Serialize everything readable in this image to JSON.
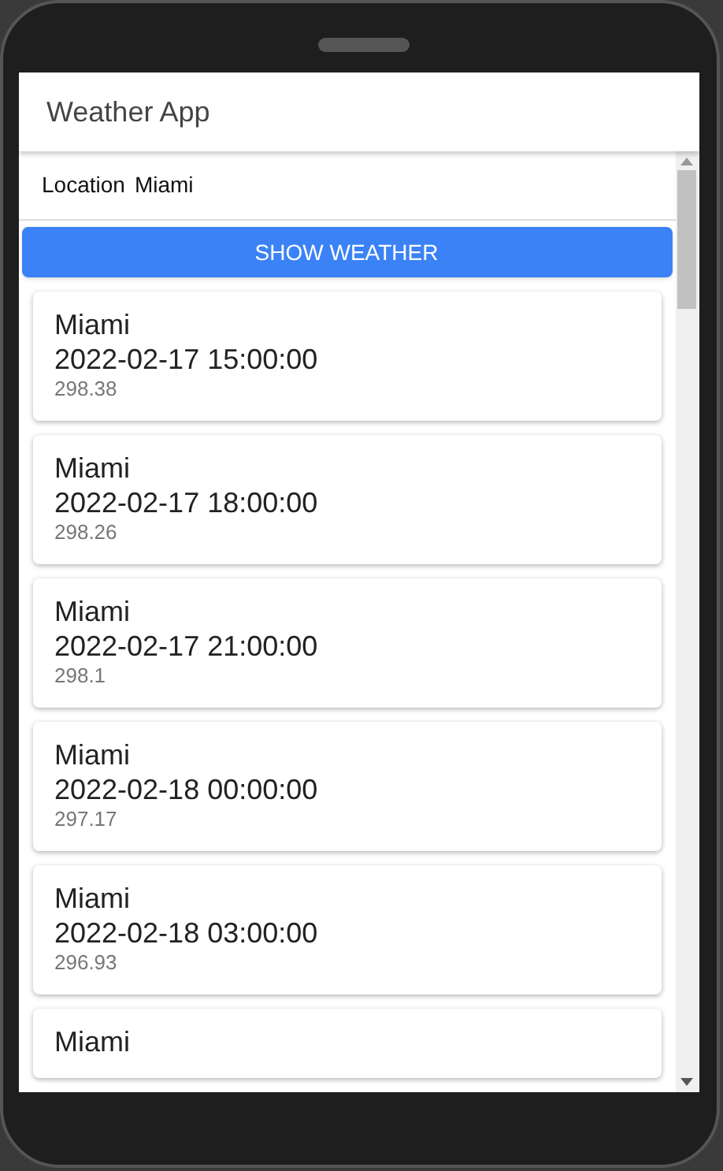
{
  "app_bar": {
    "title": "Weather App"
  },
  "location": {
    "label": "Location",
    "value": "Miami"
  },
  "button": {
    "label": "SHOW WEATHER"
  },
  "forecasts": [
    {
      "city": "Miami",
      "datetime": "2022-02-17 15:00:00",
      "temperature": "298.38"
    },
    {
      "city": "Miami",
      "datetime": "2022-02-17 18:00:00",
      "temperature": "298.26"
    },
    {
      "city": "Miami",
      "datetime": "2022-02-17 21:00:00",
      "temperature": "298.1"
    },
    {
      "city": "Miami",
      "datetime": "2022-02-18 00:00:00",
      "temperature": "297.17"
    },
    {
      "city": "Miami",
      "datetime": "2022-02-18 03:00:00",
      "temperature": "296.93"
    },
    {
      "city": "Miami"
    }
  ]
}
